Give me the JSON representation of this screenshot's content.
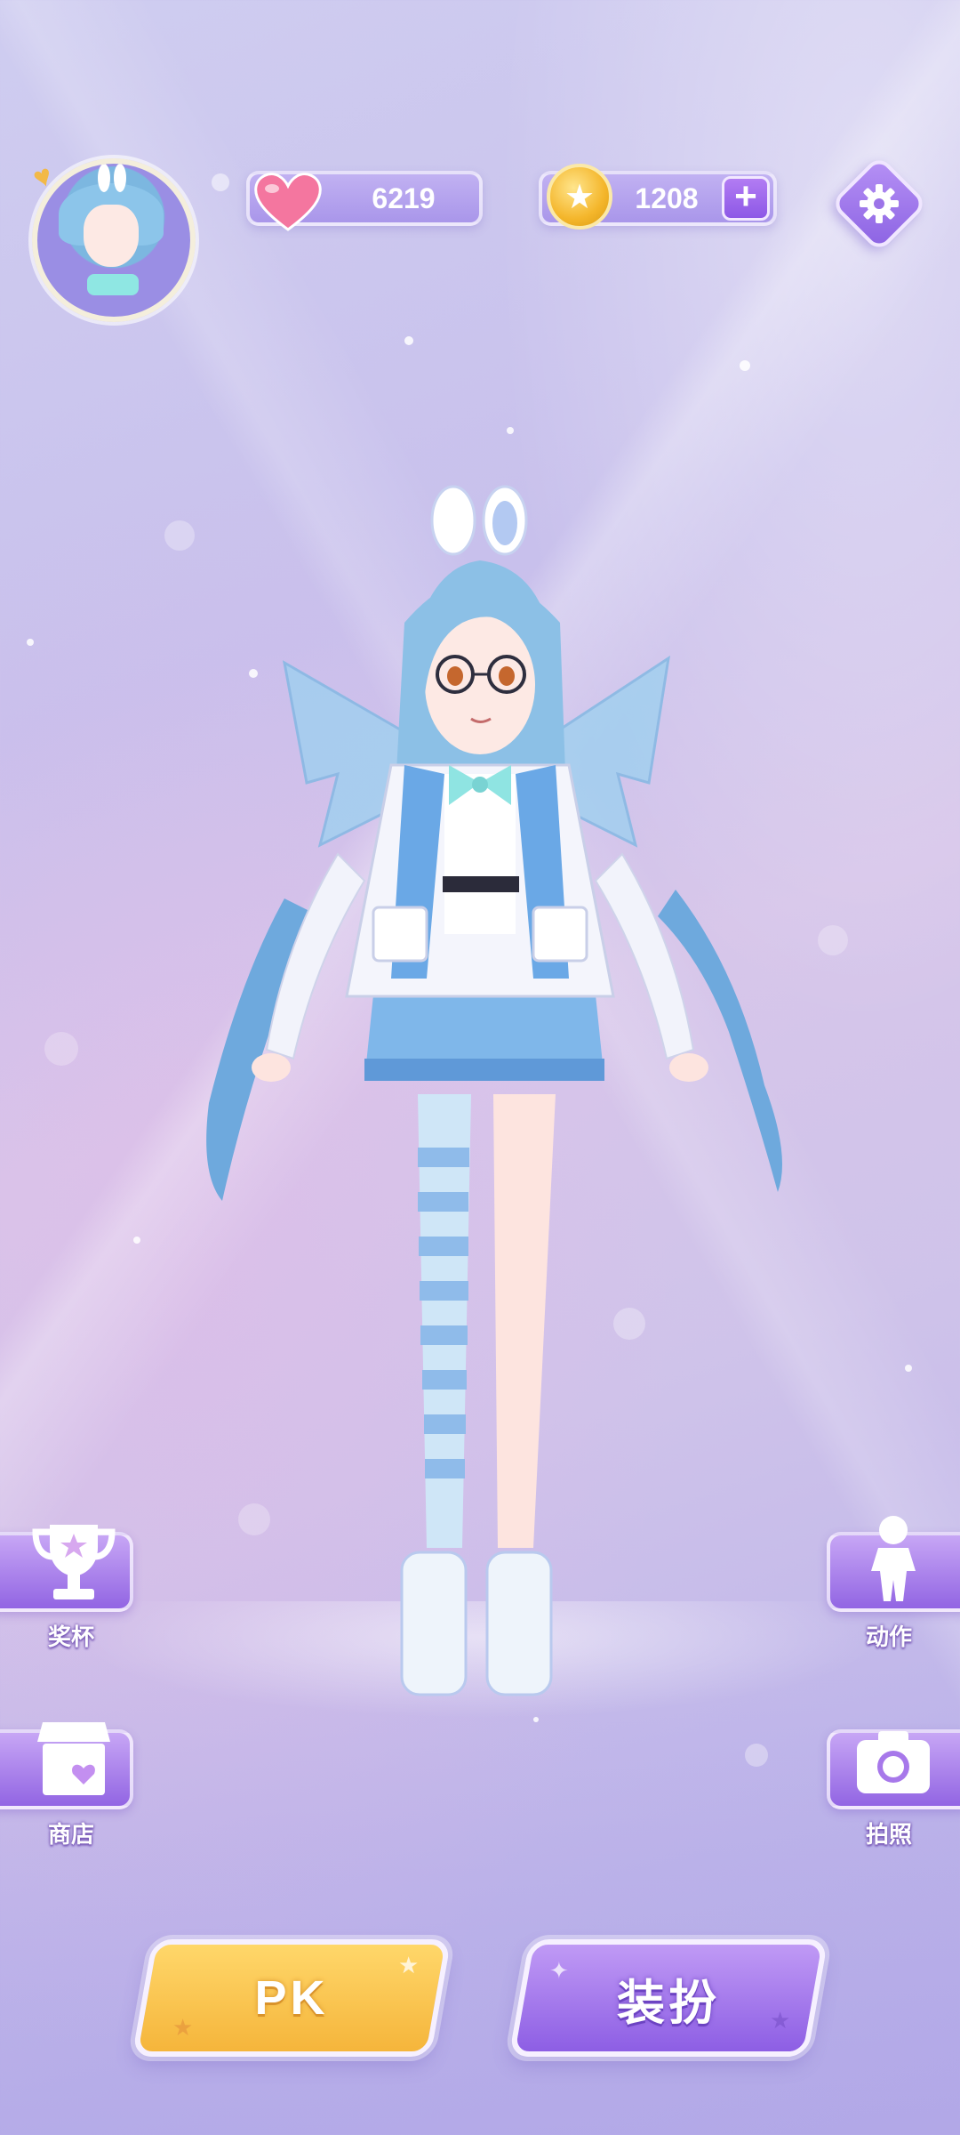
{
  "top_bar": {
    "hearts_value": "6219",
    "coins_value": "1208"
  },
  "side_menu": {
    "trophy_label": "奖杯",
    "shop_label": "商店",
    "action_label": "动作",
    "photo_label": "拍照"
  },
  "bottom_buttons": {
    "pk_label": "PK",
    "dress_label": "装扮"
  },
  "icons": {
    "heart": "heart-icon",
    "coin": "coin-icon",
    "plus": "plus-icon",
    "settings": "gear-icon",
    "trophy": "trophy-icon",
    "shop": "shop-icon",
    "action": "figure-icon",
    "photo": "camera-icon"
  },
  "colors": {
    "accent_purple": "#9265e3",
    "pk_gold": "#f5b53b",
    "heart_pink": "#f06aa0",
    "coin_gold": "#f4b62b"
  }
}
